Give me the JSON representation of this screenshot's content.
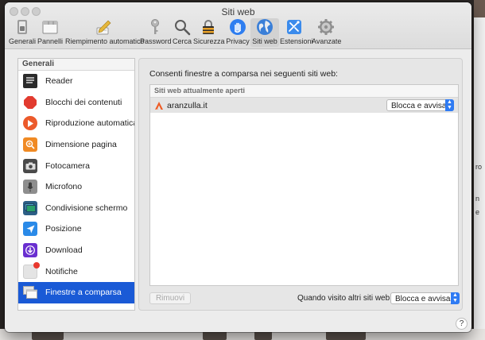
{
  "window": {
    "title": "Siti web"
  },
  "toolbar": {
    "items": [
      {
        "label": "Generali",
        "icon": "switch-icon"
      },
      {
        "label": "Pannelli",
        "icon": "tabs-icon"
      },
      {
        "label": "Riempimento automatico",
        "icon": "pencil-icon"
      },
      {
        "label": "Password",
        "icon": "key-icon"
      },
      {
        "label": "Cerca",
        "icon": "magnifier-icon"
      },
      {
        "label": "Sicurezza",
        "icon": "padlock-icon"
      },
      {
        "label": "Privacy",
        "icon": "hand-icon"
      },
      {
        "label": "Siti web",
        "icon": "globe-icon",
        "selected": true
      },
      {
        "label": "Estensioni",
        "icon": "puzzle-icon"
      },
      {
        "label": "Avanzate",
        "icon": "gear-icon"
      }
    ]
  },
  "sidebar": {
    "header": "Generali",
    "items": [
      {
        "label": "Reader",
        "icon": "reader-icon"
      },
      {
        "label": "Blocchi dei contenuti",
        "icon": "stop-sign-icon"
      },
      {
        "label": "Riproduzione automatica",
        "icon": "play-icon"
      },
      {
        "label": "Dimensione pagina",
        "icon": "zoom-icon"
      },
      {
        "label": "Fotocamera",
        "icon": "camera-icon"
      },
      {
        "label": "Microfono",
        "icon": "microphone-icon"
      },
      {
        "label": "Condivisione schermo",
        "icon": "screen-share-icon"
      },
      {
        "label": "Posizione",
        "icon": "location-icon"
      },
      {
        "label": "Download",
        "icon": "download-icon"
      },
      {
        "label": "Notifiche",
        "icon": "notifications-icon"
      },
      {
        "label": "Finestre a comparsa",
        "icon": "popup-windows-icon",
        "selected": true
      }
    ]
  },
  "main": {
    "title": "Consenti finestre a comparsa nei seguenti siti web:",
    "table_header": "Siti web attualmente aperti",
    "rows": [
      {
        "site": "aranzulla.it",
        "setting": "Blocca e avvisa"
      }
    ],
    "remove_label": "Rimuovi",
    "other_sites_label": "Quando visito altri siti web:",
    "other_sites_value": "Blocca e avvisa"
  },
  "help_label": "?",
  "colors": {
    "selection": "#1a5ad6",
    "popup_arrow": "#2f7bf3"
  }
}
